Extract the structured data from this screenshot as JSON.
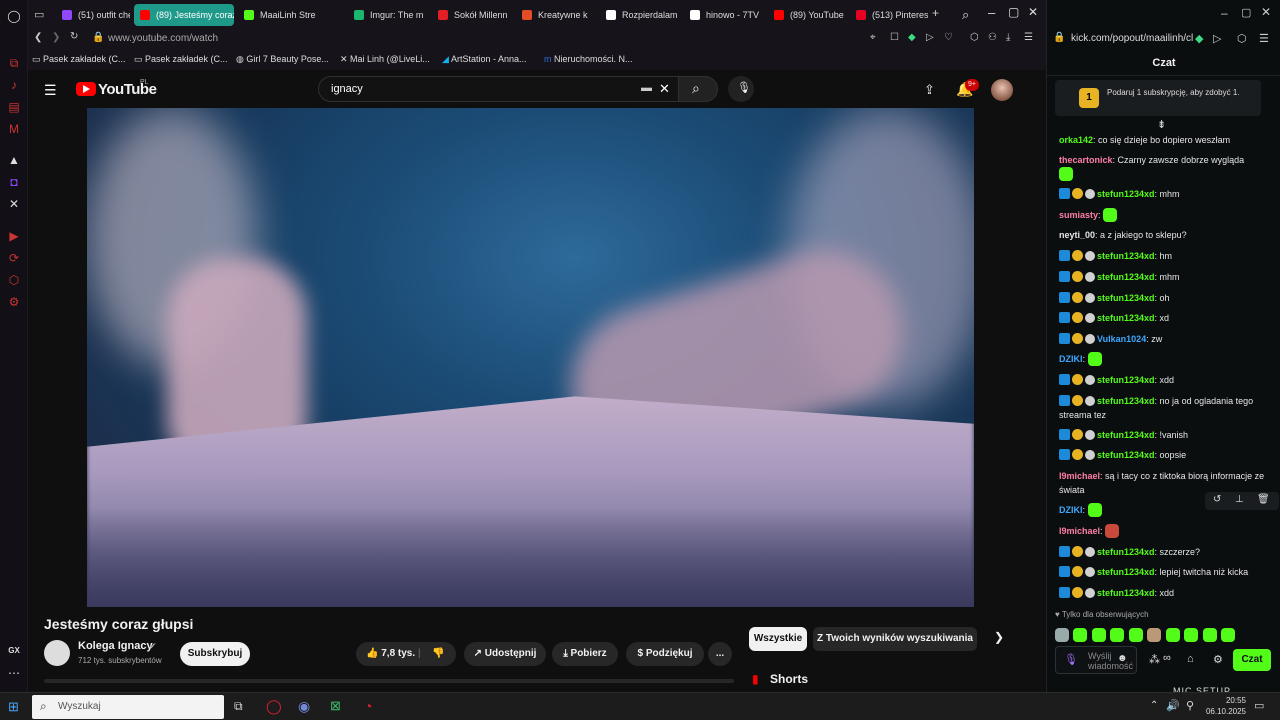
{
  "browser": {
    "tabs": [
      {
        "label": "(51) outfit che",
        "color": "#9146ff"
      },
      {
        "label": "(89) Jesteśmy coraz",
        "color": "#ff0000",
        "active": true
      },
      {
        "label": "MaaiLinh Stre",
        "color": "#53fc18"
      },
      {
        "label": "Imgur: The m",
        "color": "#1bb76e"
      },
      {
        "label": "Sokół Millenn",
        "color": "#e31e24"
      },
      {
        "label": "Kreatywne k",
        "color": "#e44d26"
      },
      {
        "label": "Rozpierdalam",
        "color": "#ffffff"
      },
      {
        "label": "hinowo - 7TV",
        "color": "#ffffff"
      },
      {
        "label": "(89) YouTube",
        "color": "#ff0000"
      },
      {
        "label": "(513) Pinterest",
        "color": "#e60023"
      }
    ],
    "url": "www.youtube.com/watch",
    "bookmarks": [
      "Pasek zakładek (C...",
      "Pasek zakładek (C...",
      "Girl 7 Beauty Pose...",
      "Mai Linh (@LiveLi...",
      "ArtStation - Anna...",
      "Nieruchomości. N..."
    ],
    "sidebar_label": "GX"
  },
  "youtube": {
    "logo": "YouTube",
    "region": "PL",
    "search_value": "ignacy",
    "notif_count": "9+",
    "video_title": "Jesteśmy coraz głupsi",
    "channel_name": "Kolega Ignacy",
    "subscribers": "712 tys. subskrybentów",
    "subscribe_label": "Subskrybuj",
    "likes": "7,8 tys.",
    "share_label": "Udostępnij",
    "download_label": "Pobierz",
    "thanks_label": "Podziękuj",
    "more_label": "...",
    "chips": [
      "Wszystkie",
      "Z Twoich wyników wyszukiwania"
    ],
    "shorts_label": "Shorts"
  },
  "kick": {
    "url": "kick.com/popout/maailinh/cl",
    "header": "Czat",
    "gift_text": "Podaruj 1 subskrypcję, aby zdobyć 1.",
    "gift_num": "1",
    "messages": [
      {
        "user": "orka142",
        "color": "#53fc18",
        "badges": false,
        "text": "co się dzieje bo dopiero weszłam"
      },
      {
        "user": "thecartonick",
        "color": "#ff7ea6",
        "badges": false,
        "text": "Czarny zawsze dobrze wygląda",
        "emote": true
      },
      {
        "user": "stefun1234xd",
        "color": "#53fc18",
        "badges": true,
        "text": "mhm"
      },
      {
        "user": "sumiasty",
        "color": "#ff7ea6",
        "badges": false,
        "text": "",
        "emote": true
      },
      {
        "user": "neyti_00",
        "color": "#e6e6e6",
        "badges": false,
        "text": "a z jakiego to sklepu?"
      },
      {
        "user": "stefun1234xd",
        "color": "#53fc18",
        "badges": true,
        "text": "hm"
      },
      {
        "user": "stefun1234xd",
        "color": "#53fc18",
        "badges": true,
        "text": "mhm"
      },
      {
        "user": "stefun1234xd",
        "color": "#53fc18",
        "badges": true,
        "text": "oh"
      },
      {
        "user": "stefun1234xd",
        "color": "#53fc18",
        "badges": true,
        "text": "xd"
      },
      {
        "user": "Vulkan1024",
        "color": "#3da9ff",
        "badges": true,
        "text": "zw"
      },
      {
        "user": "DZIKI",
        "color": "#3da9ff",
        "badges": false,
        "text": "",
        "emote": true
      },
      {
        "user": "stefun1234xd",
        "color": "#53fc18",
        "badges": true,
        "text": "xdd"
      },
      {
        "user": "stefun1234xd",
        "color": "#53fc18",
        "badges": true,
        "text": "no ja od ogladania tego streama tez"
      },
      {
        "user": "stefun1234xd",
        "color": "#53fc18",
        "badges": true,
        "text": "!vanish"
      },
      {
        "user": "stefun1234xd",
        "color": "#53fc18",
        "badges": true,
        "text": "oopsie"
      },
      {
        "user": "l9michael",
        "color": "#ff7ea6",
        "badges": false,
        "text": "są i tacy co z tiktoka biorą informacje ze świata"
      },
      {
        "user": "DZIKI",
        "color": "#3da9ff",
        "badges": false,
        "text": "",
        "emote": true
      },
      {
        "user": "l9michael",
        "color": "#ff7ea6",
        "badges": false,
        "text": "",
        "emote": true
      },
      {
        "user": "stefun1234xd",
        "color": "#53fc18",
        "badges": true,
        "text": "szczerze?"
      },
      {
        "user": "stefun1234xd",
        "color": "#53fc18",
        "badges": true,
        "text": "lepiej twitcha niż kicka"
      },
      {
        "user": "stefun1234xd",
        "color": "#53fc18",
        "badges": true,
        "text": "xdd"
      }
    ],
    "followers_only": "Tylko dla obserwujących",
    "input_placeholder": "Wyślij wiadomość",
    "send_label": "Czat",
    "mic_setup": "MIC SETUP"
  },
  "taskbar": {
    "search_placeholder": "Wyszukaj",
    "time": "20:55",
    "date": "06.10.2025"
  },
  "colors": {
    "kick_green": "#53fc18",
    "yt_red": "#ff0000",
    "gx_red": "#cc2233"
  }
}
